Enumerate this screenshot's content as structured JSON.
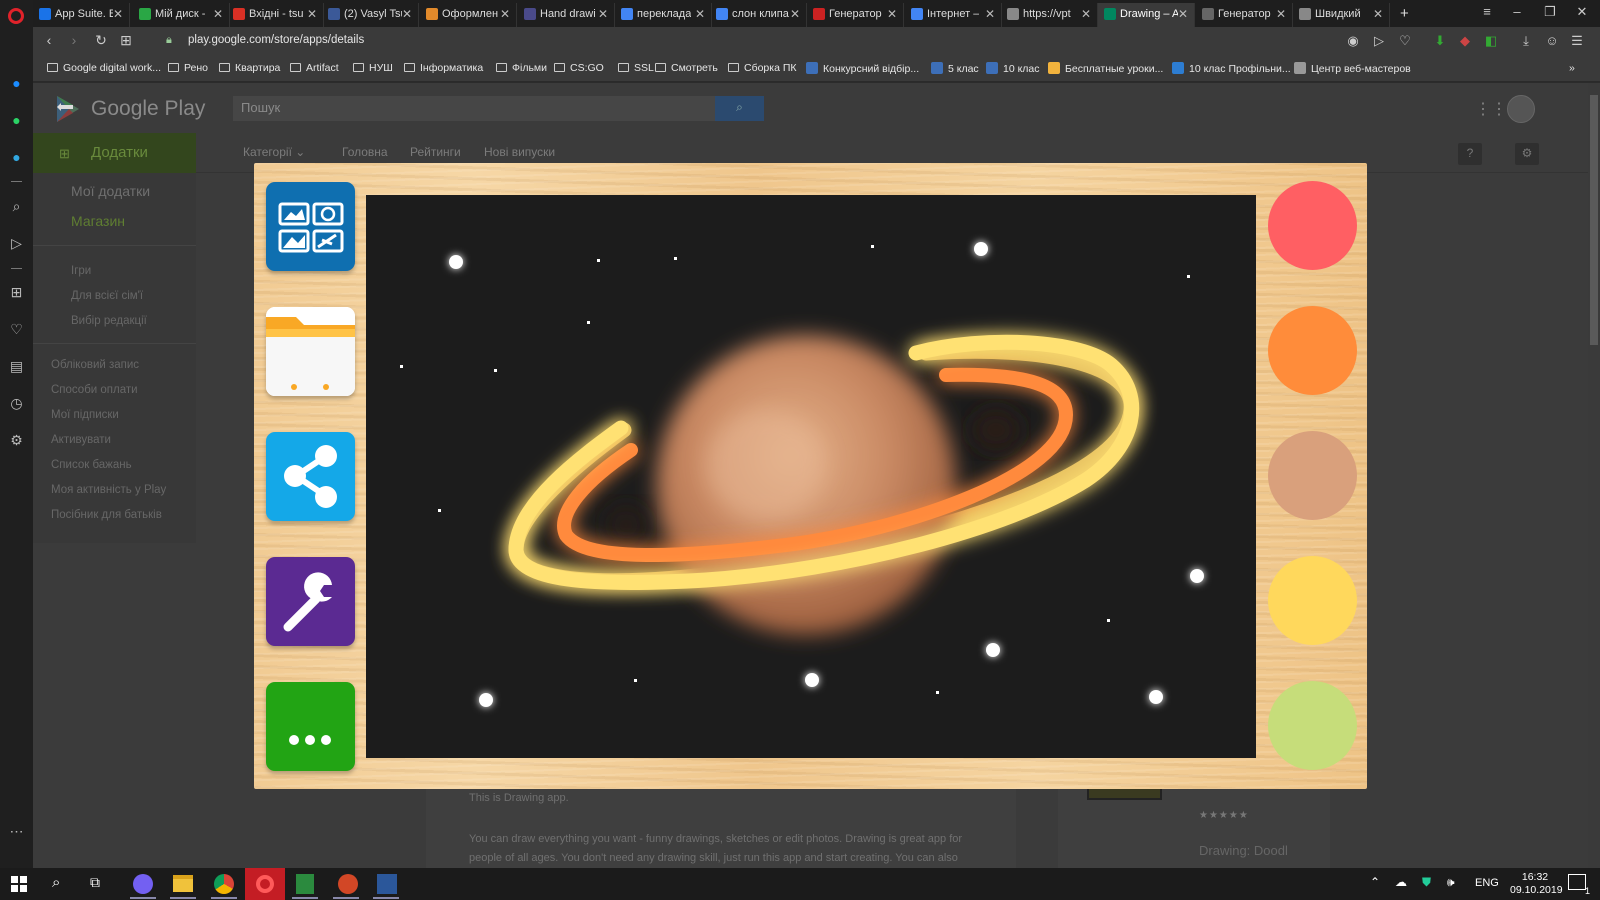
{
  "browser": {
    "tabs": [
      {
        "label": "App Suite. B",
        "color": "#1a73e8"
      },
      {
        "label": "Мій диск -",
        "color": "#2aa745"
      },
      {
        "label": "Вхідні - tsu",
        "color": "#d93025"
      },
      {
        "label": "(2) Vasyl Tsu",
        "color": "#3b5998"
      },
      {
        "label": "Оформлен",
        "color": "#e28a2b"
      },
      {
        "label": "Hand drawi",
        "color": "#4a4a8a"
      },
      {
        "label": "переклада",
        "color": "#4285f4"
      },
      {
        "label": "слон клипа",
        "color": "#4285f4"
      },
      {
        "label": "Генератор",
        "color": "#cc2222"
      },
      {
        "label": "Інтернет –",
        "color": "#4285f4"
      },
      {
        "label": "https://vpt",
        "color": "#888888"
      },
      {
        "label": "Drawing – A",
        "color": "#01875f",
        "active": true
      },
      {
        "label": "Генератор",
        "color": "#666666"
      },
      {
        "label": "Швидкий",
        "color": "#888888"
      }
    ],
    "url": "play.google.com/store/apps/details",
    "bookmarks": [
      {
        "label": "Google digital work...",
        "type": "folder"
      },
      {
        "label": "Рено",
        "type": "folder"
      },
      {
        "label": "Квартира",
        "type": "folder"
      },
      {
        "label": "Artifact",
        "type": "folder"
      },
      {
        "label": "НУШ",
        "type": "folder"
      },
      {
        "label": "Інформатика",
        "type": "folder"
      },
      {
        "label": "Фільми",
        "type": "folder"
      },
      {
        "label": "CS:GO",
        "type": "folder"
      },
      {
        "label": "SSL",
        "type": "folder"
      },
      {
        "label": "Смотреть",
        "type": "folder"
      },
      {
        "label": "Сборка ПК",
        "type": "folder"
      },
      {
        "label": "Конкурсний відбір...",
        "type": "site"
      },
      {
        "label": "5 клас",
        "type": "site"
      },
      {
        "label": "10 клас",
        "type": "site"
      },
      {
        "label": "Бесплатные уроки...",
        "type": "site"
      },
      {
        "label": "10 клас Профільни...",
        "type": "site"
      },
      {
        "label": "Центр веб-мастеров",
        "type": "site"
      }
    ],
    "more_bookmarks": "»"
  },
  "play": {
    "brand": "Google Play",
    "search_placeholder": "Пошук",
    "category_tab": "Додатки",
    "nav_links": [
      "Категорії ⌄",
      "Головна",
      "Рейтинги",
      "Нові випуски"
    ],
    "sidebar_main": [
      "Мої додатки",
      "Магазин"
    ],
    "sidebar_sub": [
      "Ігри",
      "Для всієї сім'ї",
      "Вибір редакції"
    ],
    "sidebar_account": [
      "Обліковий запис",
      "Способи оплати",
      "Мої підписки",
      "Активувати",
      "Список бажань",
      "Моя активність у Play",
      "Посібник для батьків"
    ],
    "description": [
      "This is Drawing app.",
      "You can draw everything you want - funny drawings, sketches or edit photos. Drawing is great app for",
      "people of all ages. You don't need any drawing skill, just run this app and start creating. You can also"
    ],
    "right_label": "Drawing: Doodl",
    "stars": "★★★★★"
  },
  "app": {
    "tools": [
      "gallery-icon",
      "files-icon",
      "share-icon",
      "settings-icon",
      "more-icon"
    ],
    "palette": [
      "#ff5f63",
      "#ff8c3a",
      "#d9a07c",
      "#ffd85c",
      "#c6dd7a"
    ]
  },
  "taskbar": {
    "language": "ENG",
    "time": "16:32",
    "date": "09.10.2019",
    "notifications": "1"
  }
}
